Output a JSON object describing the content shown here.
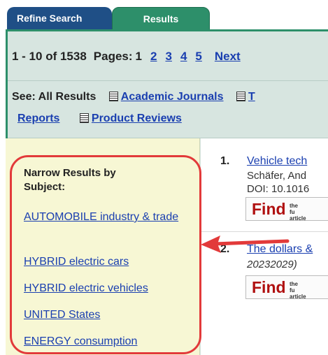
{
  "tabs": {
    "refine": "Refine Search",
    "results": "Results"
  },
  "pagination": {
    "range": "1 - 10 of 1538",
    "pages_label": "Pages:",
    "current_page": "1",
    "pages": [
      "2",
      "3",
      "4",
      "5"
    ],
    "next": "Next"
  },
  "see": {
    "label": "See: All Results",
    "academic_journals": "Academic Journals",
    "reports_partial": "Reports",
    "product_reviews": "Product Reviews",
    "icon": "document-icon"
  },
  "sidebar": {
    "title": "Narrow Results by Subject:",
    "subjects": [
      "AUTOMOBILE industry & trade",
      "HYBRID electric cars",
      "HYBRID electric vehicles",
      "UNITED States",
      "ENERGY consumption"
    ]
  },
  "results": [
    {
      "number": "1.",
      "title": "Vehicle tech",
      "authors": "Schäfer, And",
      "doi": "DOI: 10.1016",
      "find": "Find",
      "find_small": "the fu article"
    },
    {
      "number": "2.",
      "title": "The dollars &",
      "meta": "20232029)",
      "find": "Find",
      "find_small": "the fu article"
    }
  ],
  "colors": {
    "tab_refine": "#1f4f86",
    "tab_results": "#2d8f6a",
    "link": "#1a3fb0",
    "highlight": "#e23a3a",
    "sidebar_bg": "#f7f7d4"
  }
}
